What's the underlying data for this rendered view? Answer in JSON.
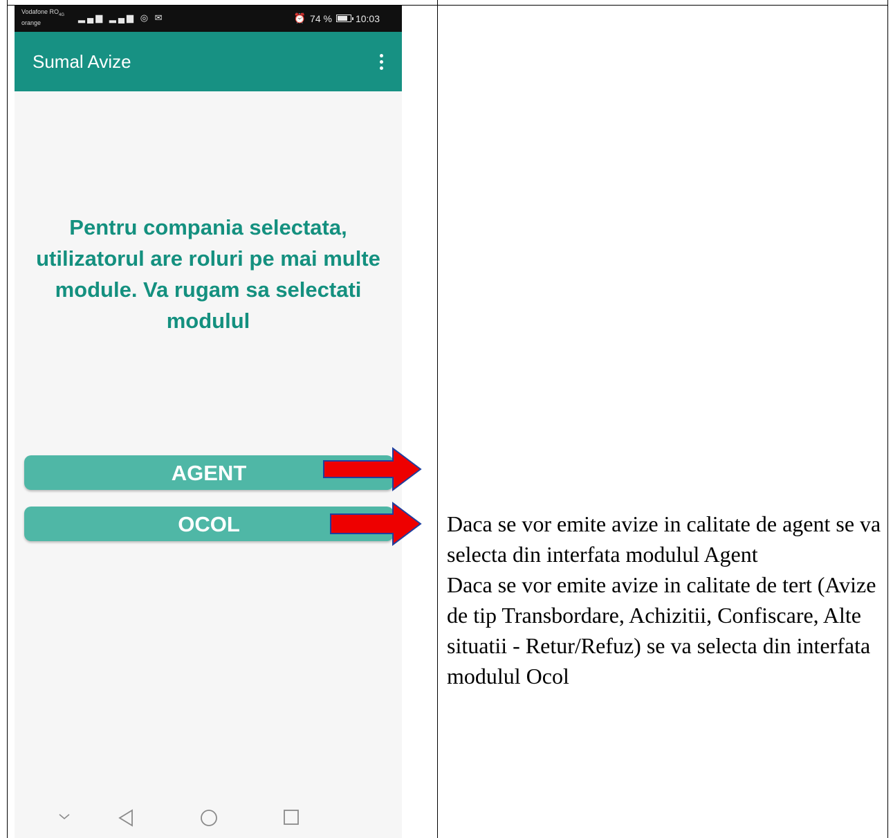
{
  "status_bar": {
    "carrier_line1": "Vodafone RO",
    "carrier_line2": "orange",
    "network": "4G",
    "battery": "74 %",
    "time": "10:03"
  },
  "app": {
    "title": "Sumal Avize",
    "accent_color": "#179183",
    "button_color": "#4fb7a6"
  },
  "message": "Pentru compania selectata, utilizatorul are roluri pe mai multe module. Va rugam sa selectati modulul",
  "modules": {
    "agent_label": "AGENT",
    "ocol_label": "OCOL"
  },
  "nav_bar": [
    "chevron-down-icon",
    "back-icon",
    "home-icon",
    "recents-icon"
  ],
  "arrow_color": "#ee0000",
  "description": {
    "line1": "Daca se vor emite avize in calitate de agent se va  selecta din interfata modulul Agent",
    "line2": "Daca se vor emite avize in calitate de tert (Avize de tip Transbordare, Achizitii, Confiscare, Alte situatii  -  Retur/Refuz) se va  selecta din interfata modulul Ocol"
  }
}
